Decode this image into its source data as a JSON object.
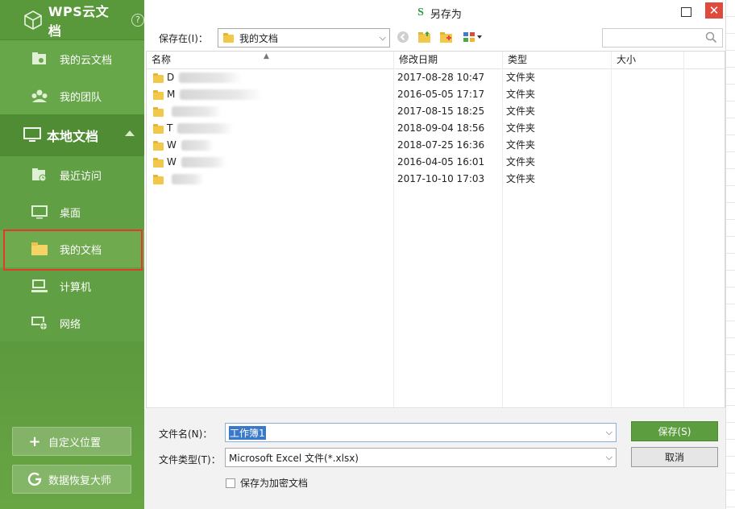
{
  "sidebar": {
    "title": "WPS云文档",
    "help": "?",
    "cloud_items": [
      {
        "label": "我的云文档",
        "icon": "cloud-folder-icon"
      },
      {
        "label": "我的团队",
        "icon": "team-icon"
      }
    ],
    "local_section": {
      "label": "本地文档",
      "icon": "monitor-icon"
    },
    "local_items": [
      {
        "label": "最近访问",
        "icon": "recent-folder-icon"
      },
      {
        "label": "桌面",
        "icon": "desktop-icon"
      },
      {
        "label": "我的文档",
        "icon": "folder-icon",
        "active": true
      },
      {
        "label": "计算机",
        "icon": "computer-icon"
      },
      {
        "label": "网络",
        "icon": "network-icon"
      }
    ],
    "buttons": [
      {
        "label": "自定义位置",
        "icon": "plus-icon"
      },
      {
        "label": "数据恢复大师",
        "icon": "recovery-icon"
      }
    ]
  },
  "dialog": {
    "logo": "S",
    "title": "另存为",
    "save_in_label": "保存在(I)：",
    "save_in_value": "我的文档"
  },
  "list": {
    "columns": [
      "名称",
      "修改日期",
      "类型",
      "大小"
    ],
    "rows": [
      {
        "name": "D",
        "date": "2017-08-28 10:47",
        "type": "文件夹"
      },
      {
        "name": "M",
        "date": "2016-05-05 17:17",
        "type": "文件夹"
      },
      {
        "name": "",
        "date": "2017-08-15 18:25",
        "type": "文件夹"
      },
      {
        "name": "T",
        "date": "2018-09-04 18:56",
        "type": "文件夹"
      },
      {
        "name": "W",
        "date": "2018-07-25 16:36",
        "type": "文件夹"
      },
      {
        "name": "W",
        "date": "2016-04-05 16:01",
        "type": "文件夹"
      },
      {
        "name": "",
        "date": "2017-10-10 17:03",
        "type": "文件夹"
      }
    ]
  },
  "form": {
    "filename_label": "文件名(N)：",
    "filename_value": "工作簿1",
    "filetype_label": "文件类型(T)：",
    "filetype_value": "Microsoft Excel 文件(*.xlsx)",
    "encrypt_label": "保存为加密文档",
    "save_button": "保存(S)",
    "cancel_button": "取消"
  },
  "colors": {
    "accent": "#5c9e3f",
    "close": "#e04a3c",
    "highlight": "#e23b2b"
  }
}
